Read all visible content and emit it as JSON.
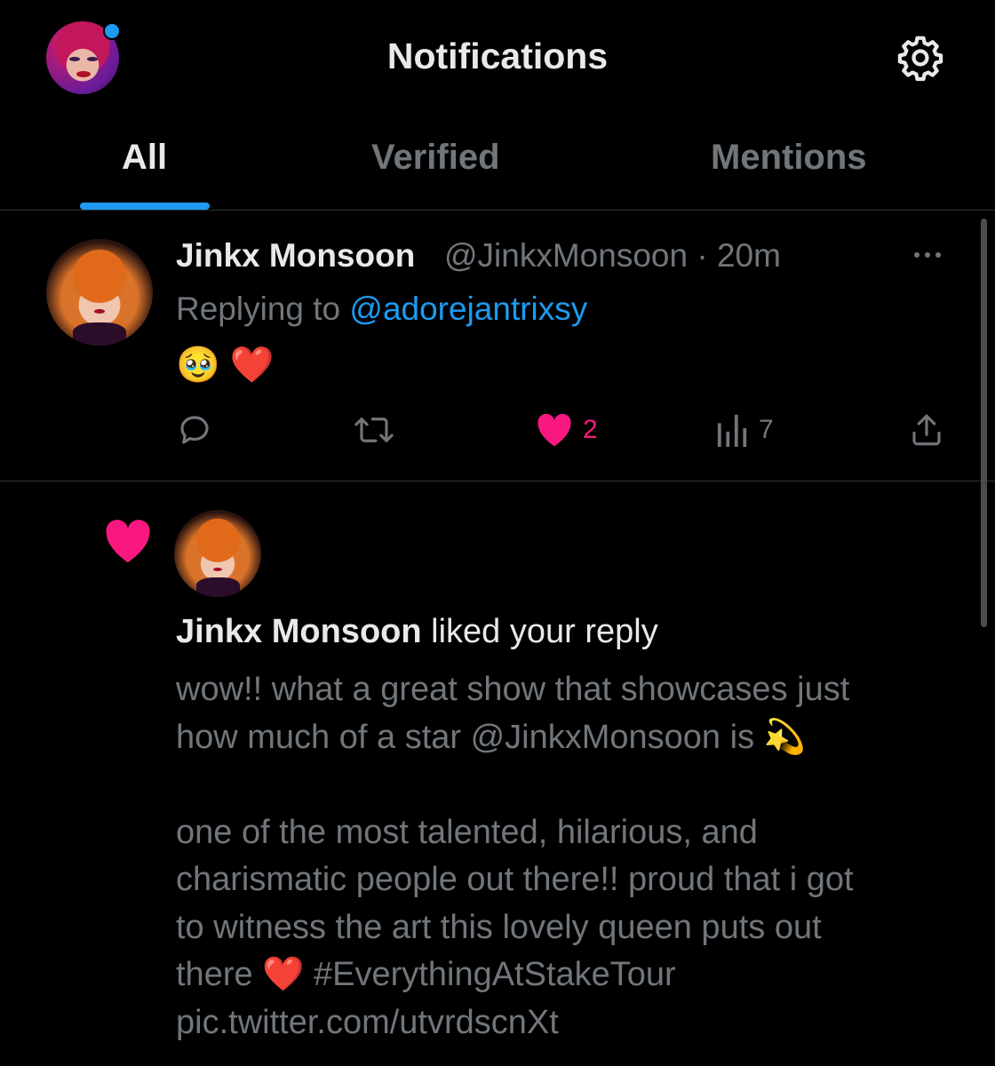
{
  "header": {
    "title": "Notifications",
    "accent_color": "#1d9bf0"
  },
  "tabs": [
    {
      "label": "All",
      "active": true
    },
    {
      "label": "Verified",
      "active": false
    },
    {
      "label": "Mentions",
      "active": false
    }
  ],
  "tweet": {
    "author_name": "Jinkx Monsoon",
    "handle_time": "@JinkxMonsoon · 20m",
    "replying_prefix": "Replying to",
    "replying_to": "@adorejantrixsy",
    "text": "🥹 ❤️",
    "like_count": "2",
    "view_count": "7",
    "like_color": "#f91880"
  },
  "notification": {
    "actor": "Jinkx Monsoon",
    "action": "liked your reply",
    "paragraphs": [
      [
        "wow!! what a great show that showcases just",
        "how much of a star @JinkxMonsoon is 💫"
      ],
      [
        "one of the most talented, hilarious, and",
        "charismatic people out there!! proud that i got",
        "to witness the art this lovely queen puts out",
        "there ❤️ #EverythingAtStakeTour",
        "pic.twitter.com/utvrdscnXt"
      ]
    ]
  },
  "icons": {
    "settings": "gear-icon",
    "more": "more-icon",
    "reply": "reply-icon",
    "retweet": "retweet-icon",
    "like": "heart-icon",
    "views": "views-icon",
    "share": "share-icon"
  }
}
